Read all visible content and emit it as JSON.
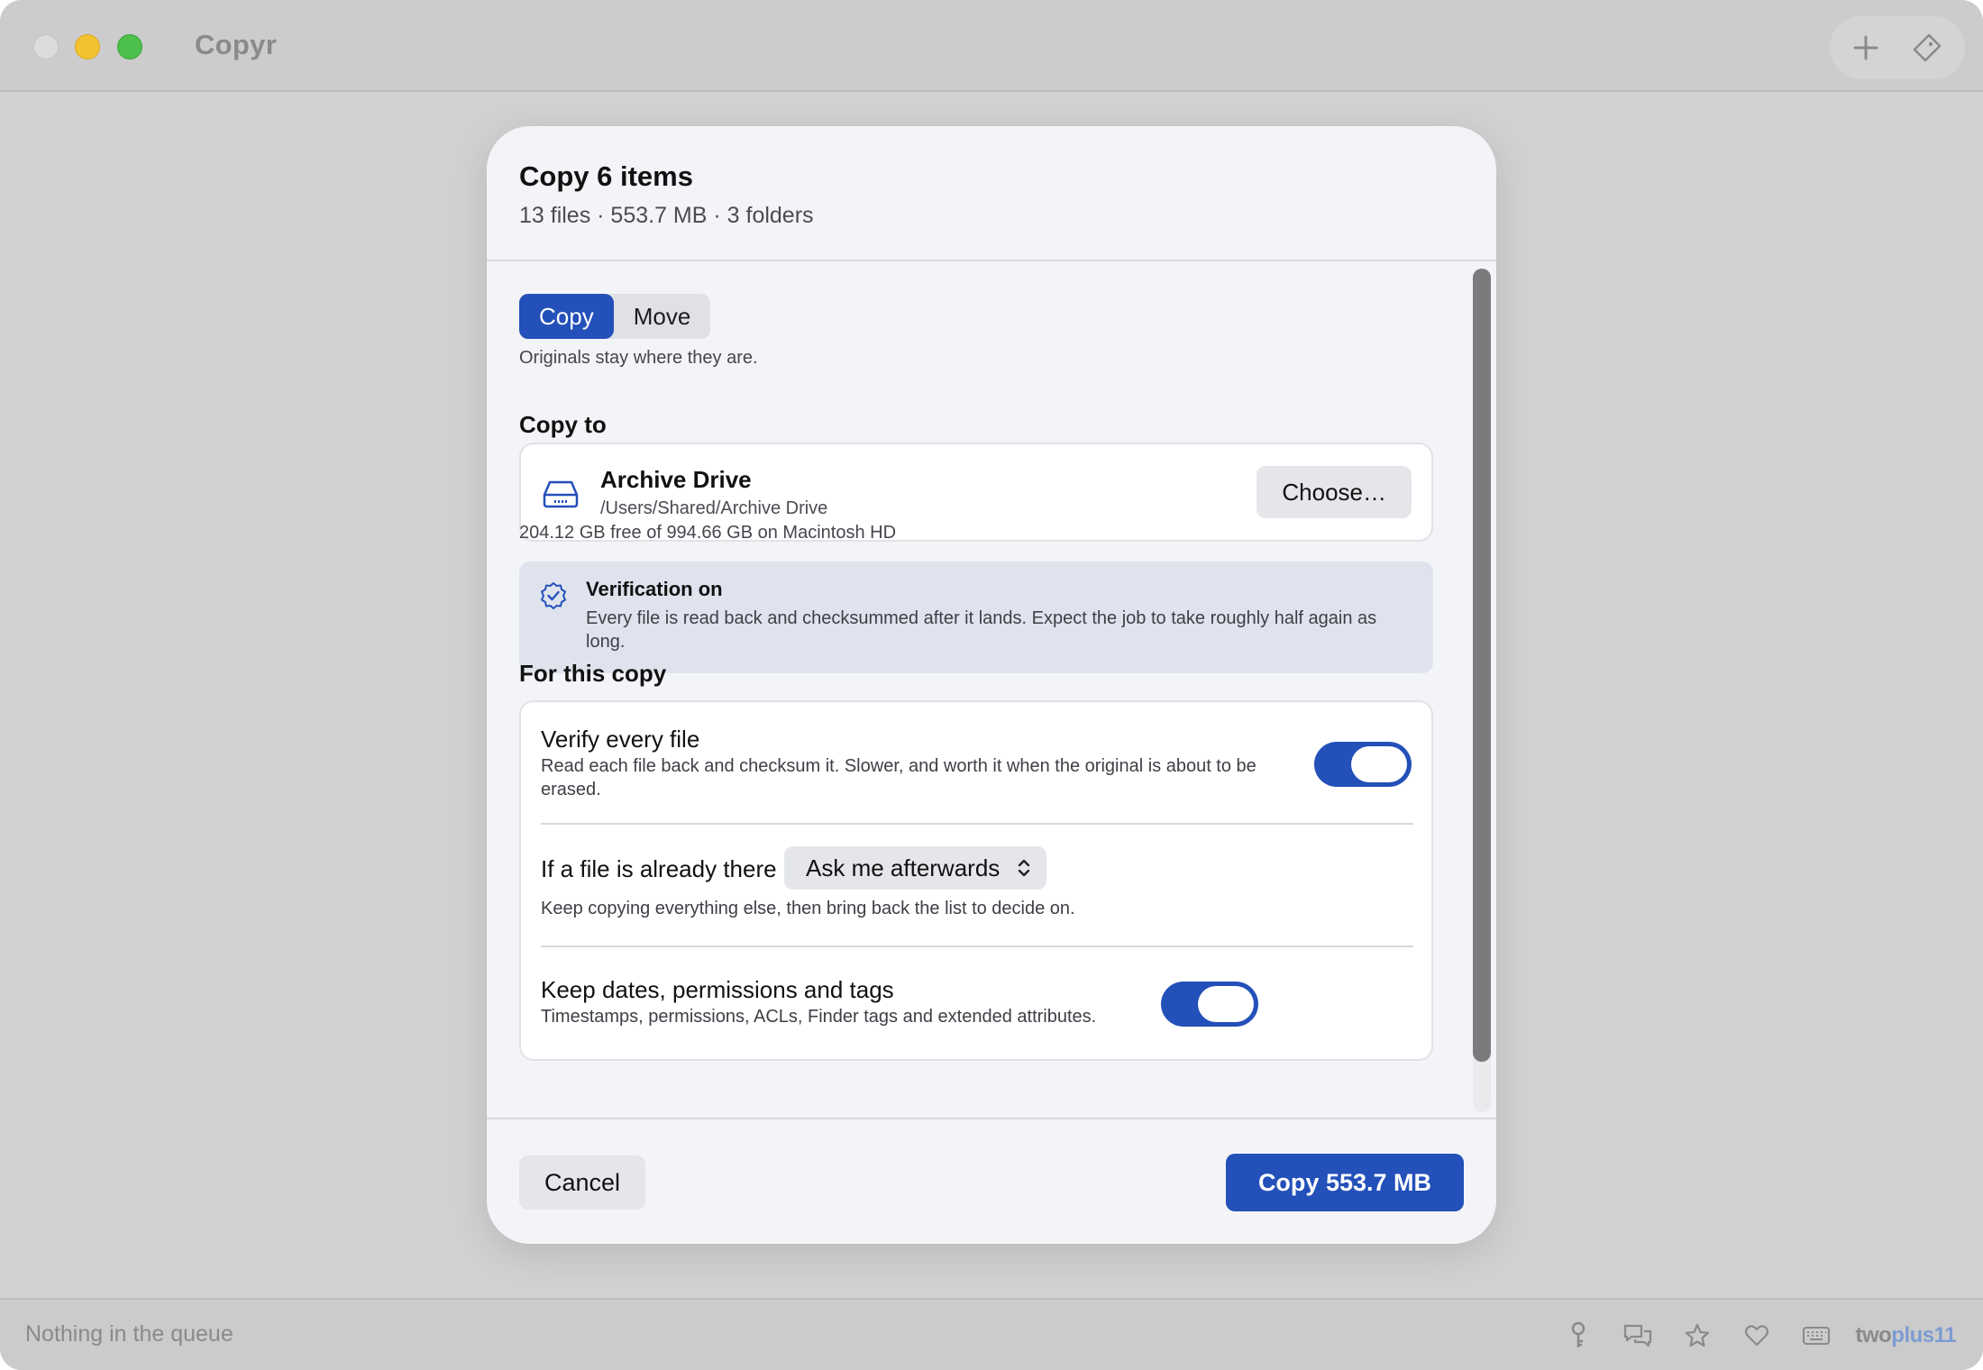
{
  "window": {
    "app_title": "Copyr"
  },
  "toolbar": {
    "add_icon": "plus-icon",
    "tag_icon": "tag-icon"
  },
  "dialog": {
    "title": "Copy 6 items",
    "subtitle": "13 files · 553.7 MB · 3 folders",
    "mode": {
      "options": [
        "Copy",
        "Move"
      ],
      "selected": "Copy",
      "hint": "Originals stay where they are."
    },
    "destination": {
      "section_title": "Copy to",
      "name": "Archive Drive",
      "path": "/Users/Shared/Archive Drive",
      "choose_label": "Choose…",
      "free_space": "204.12 GB free of 994.66 GB on Macintosh HD",
      "icon": "drive-icon"
    },
    "verification_banner": {
      "title": "Verification on",
      "text": "Every file is read back and checksummed after it lands. Expect the job to take roughly half again as long.",
      "icon": "verified-badge-icon"
    },
    "options": {
      "section_title": "For this copy",
      "verify": {
        "title": "Verify every file",
        "desc": "Read each file back and checksum it. Slower, and worth it when the original is about to be erased.",
        "enabled": true
      },
      "conflict": {
        "title": "If a file is already there",
        "selected": "Ask me afterwards",
        "desc": "Keep copying everything else, then bring back the list to decide on."
      },
      "metadata": {
        "title": "Keep dates, permissions and tags",
        "desc": "Timestamps, permissions, ACLs, Finder tags and extended attributes.",
        "enabled": true
      }
    },
    "footer": {
      "cancel_label": "Cancel",
      "primary_label": "Copy 553.7 MB"
    }
  },
  "statusbar": {
    "text": "Nothing in the queue",
    "icons": [
      "key-icon",
      "chat-icon",
      "star-icon",
      "heart-icon",
      "keyboard-icon"
    ],
    "brand_part1": "two",
    "brand_part2": "plus11"
  },
  "colors": {
    "accent": "#2350b9",
    "dialog_bg": "#f3f4f8",
    "banner_bg": "#dfe3ee",
    "window_bg": "#d1d1d1"
  }
}
